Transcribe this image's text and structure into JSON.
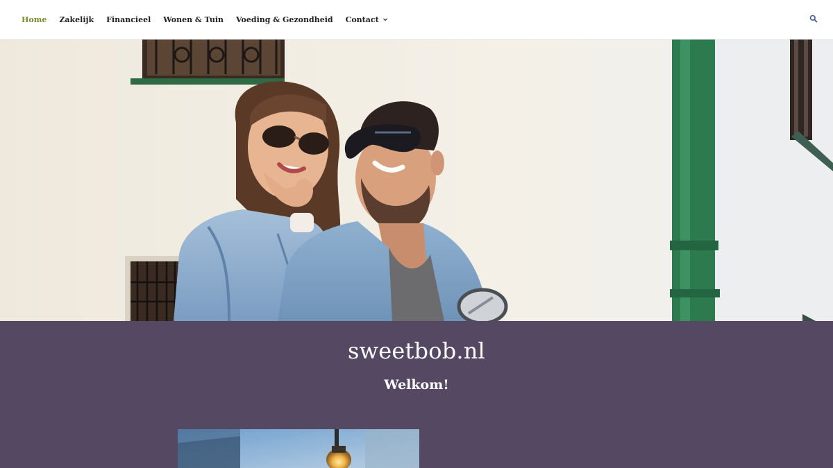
{
  "nav": {
    "items": [
      {
        "label": "Home",
        "active": true
      },
      {
        "label": "Zakelijk"
      },
      {
        "label": "Financieel"
      },
      {
        "label": "Wonen & Tuin"
      },
      {
        "label": "Voeding & Gezondheid"
      },
      {
        "label": "Contact",
        "has_dropdown": true
      }
    ],
    "search_icon": "search-icon"
  },
  "hero": {
    "image": "couple-with-sunglasses-photo"
  },
  "site": {
    "title": "sweetbob.nl",
    "tagline": "Welkom!"
  },
  "post": {
    "thumbnail": "lightbulb-photo"
  },
  "colors": {
    "accent": "#7b8a2e",
    "band": "#554862",
    "nav_text": "#1f1f1f",
    "search_icon": "#3a5f8f"
  }
}
